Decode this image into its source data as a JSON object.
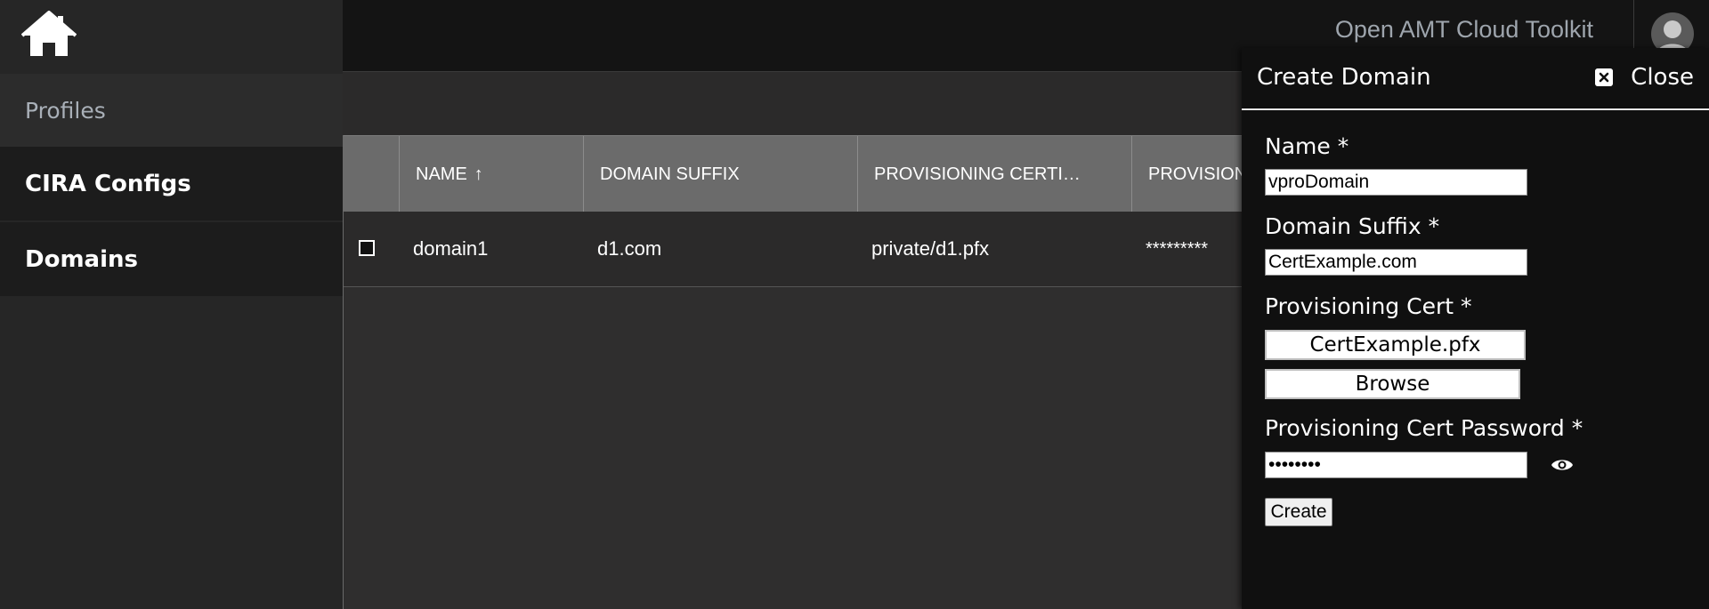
{
  "app": {
    "title": "Open AMT Cloud Toolkit"
  },
  "icons": {
    "home": "home-icon",
    "avatar": "user-avatar-icon",
    "sort": "arrow-up-icon",
    "close": "close-icon",
    "reveal": "eye-icon"
  },
  "sidebar": {
    "items": [
      {
        "label": "Profiles"
      },
      {
        "label": "CIRA Configs"
      },
      {
        "label": "Domains"
      }
    ]
  },
  "table": {
    "columns": [
      "NAME",
      "DOMAIN SUFFIX",
      "PROVISIONING CERTI…",
      "PROVISIONI"
    ],
    "sort_indicator": "↑",
    "rows": [
      {
        "name": "domain1",
        "suffix": "d1.com",
        "cert": "private/d1.pfx",
        "password": "*********"
      }
    ]
  },
  "drawer": {
    "title": "Create Domain",
    "close_label": "Close",
    "fields": {
      "name": {
        "label": "Name *",
        "value": "vproDomain"
      },
      "suffix": {
        "label": "Domain Suffix *",
        "value": "CertExample.com"
      },
      "cert": {
        "label": "Provisioning Cert *",
        "file_name": "CertExample.pfx",
        "browse_label": "Browse"
      },
      "password": {
        "label": "Provisioning Cert Password *",
        "value": "••••••••"
      }
    },
    "create_label": "Create"
  },
  "colors": {
    "background": "#2e2d2d",
    "sidebar": "#262626",
    "header": "#6b6b6b",
    "drawer": "#101010"
  }
}
